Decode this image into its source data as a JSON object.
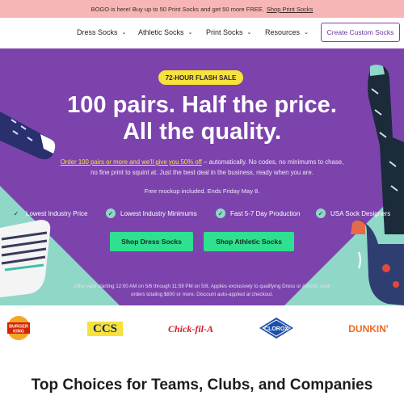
{
  "promo": {
    "text": "BOGO is here! Buy up to 50 Print Socks and get 50 more FREE.",
    "link": "Shop Print Socks"
  },
  "nav": {
    "items": [
      {
        "label": "Dress Socks"
      },
      {
        "label": "Athletic Socks"
      },
      {
        "label": "Print Socks"
      },
      {
        "label": "Resources"
      }
    ],
    "cta": "Create Custom Socks"
  },
  "hero": {
    "badge": "72-HOUR FLASH SALE",
    "headline": "100 pairs. Half the price. All the quality.",
    "sub_highlight": "Order 100 pairs or more and we'll give you 50% off",
    "sub_rest": " – automatically. No codes, no minimums to chase, no fine print to squint at. Just the best deal in the business, ready when you are.",
    "mockup_note": "Free mockup included. Ends Friday May 8.",
    "benefits": [
      {
        "label": "Lowest Industry Price"
      },
      {
        "label": "Lowest Industry Minimums"
      },
      {
        "label": "Fast 5-7 Day Production"
      },
      {
        "label": "USA Sock Designers"
      }
    ],
    "buttons": {
      "dress": "Shop Dress Socks",
      "athletic": "Shop Athletic Socks"
    },
    "fine_print": "Offer valid starting 12:00 AM on 5/6 through 11:59 PM on 5/8. Applies exclusively to qualifying Dress or Athletic sock orders totaling $800 or more. Discount auto-applied at checkout."
  },
  "logos": {
    "burger_king_top": "BURGER",
    "burger_king_bottom": "KING",
    "ccs": "CCS",
    "chickfila": "Chick-fil-A",
    "clorox": "CLOROX",
    "dunkin": "DUNKIN'"
  },
  "section": {
    "title": "Top Choices for Teams, Clubs, and Companies"
  },
  "colors": {
    "hero_bg": "#7c43ad",
    "promo_bg": "#f6b6b6",
    "accent_yellow": "#f6e23a",
    "accent_green": "#2ee08f",
    "accent_teal": "#8fd7c7"
  }
}
